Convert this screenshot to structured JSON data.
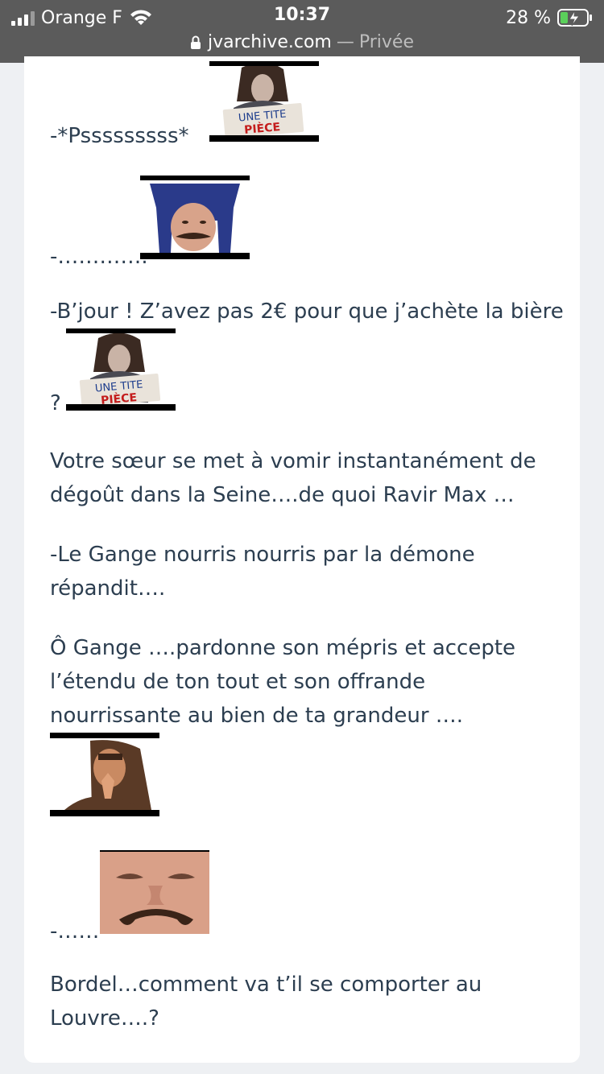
{
  "status_bar": {
    "carrier": "Orange F",
    "time": "10:37",
    "battery": "28 %",
    "url_host": "jvarchive.com",
    "url_sep": "—",
    "url_mode": "Privée"
  },
  "post": {
    "line1": "-*Psssssssss*",
    "line2": "-………….",
    "line3": "-B’jour ! Z’avez pas 2€ pour que j’achète la bière",
    "line3b": "?",
    "para1": "Votre sœur se met à vomir instantanément de dégoût dans la Seine….de quoi Ravir Max …",
    "para2": "-Le Gange nourris nourris par la démone répandit….",
    "para3": "Ô Gange ….pardonne son mépris et accepte l’étendu de ton tout et son offrande nourrissante au bien de ta grandeur ….",
    "line4": "-……",
    "para4": "Bordel…comment va t’il se comporter au Louvre….?",
    "sign_text_1": "UNE TITE",
    "sign_text_2": "PIÈCE"
  }
}
